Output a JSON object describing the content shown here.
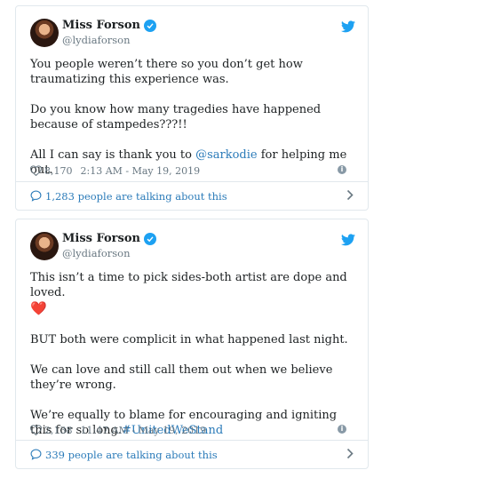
{
  "tweets": [
    {
      "name": "Miss Forson",
      "handle": "@lydiaforson",
      "paragraphs": [
        "You people weren’t there so you don’t get how traumatizing this experience was.",
        "Do you know how many tragedies have happened because of stampedes???!!"
      ],
      "last_prefix": "All I can say is thank you to ",
      "mention": "@sarkodie",
      "last_suffix": " for helping me out.",
      "likes": "8,170",
      "timestamp": "2:13 AM - May 19, 2019",
      "talking": "1,283 people are talking about this"
    },
    {
      "name": "Miss Forson",
      "handle": "@lydiaforson",
      "line1": "This isn’t a time to pick sides-both artist are dope and loved.",
      "heart_emoji": "❤️",
      "paragraphs": [
        "BUT both were complicit in what happened last night.",
        "We can love and still call them out when we believe they’re wrong."
      ],
      "last_prefix": "We’re equally to blame for encouraging and igniting this for so long.",
      "hashtag": "#UnitedWeStand",
      "likes": "2,138",
      "timestamp": "11:47 AM - May 19, 2019",
      "talking": "339 people are talking about this"
    }
  ],
  "icons": {
    "verified": "verified-badge-icon",
    "bird": "twitter-bird-icon",
    "like": "heart-outline-icon",
    "info": "info-icon",
    "reply": "speech-bubble-icon",
    "chevron": "chevron-right-icon"
  },
  "colors": {
    "accent": "#1da1f2",
    "link": "#2b7bb9",
    "muted": "#697882",
    "border": "#e1e8ed",
    "heart": "#e0245e"
  }
}
